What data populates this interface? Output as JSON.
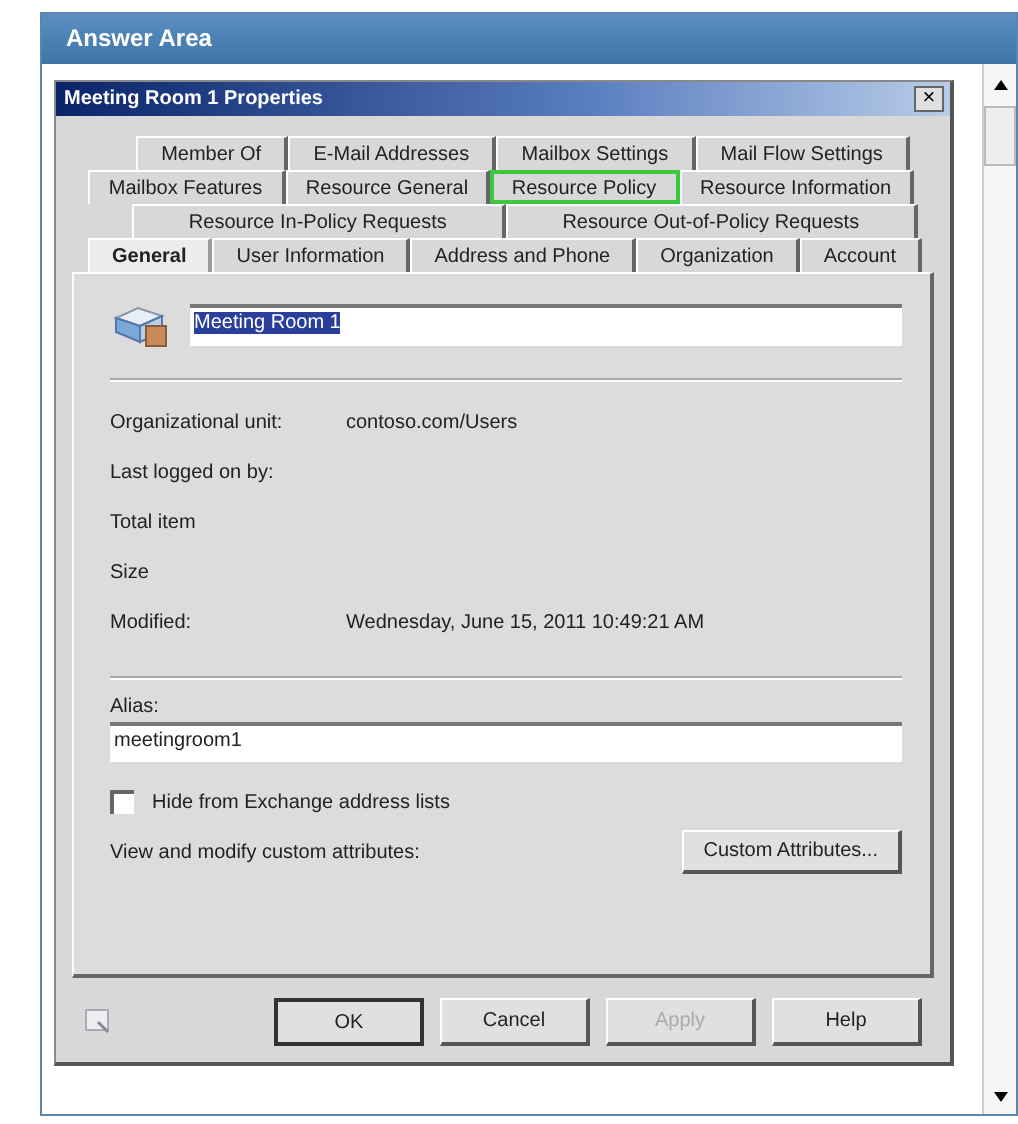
{
  "panel": {
    "title": "Answer Area"
  },
  "dialog": {
    "title": "Meeting Room 1 Properties",
    "close": "×"
  },
  "tab_rows": [
    [
      {
        "label": "Member Of",
        "selected": false,
        "highlighted": false
      },
      {
        "label": "E-Mail Addresses",
        "selected": false,
        "highlighted": false
      },
      {
        "label": "Mailbox Settings",
        "selected": false,
        "highlighted": false
      },
      {
        "label": "Mail Flow Settings",
        "selected": false,
        "highlighted": false
      }
    ],
    [
      {
        "label": "Mailbox Features",
        "selected": false,
        "highlighted": false
      },
      {
        "label": "Resource General",
        "selected": false,
        "highlighted": false
      },
      {
        "label": "Resource Policy",
        "selected": false,
        "highlighted": true
      },
      {
        "label": "Resource Information",
        "selected": false,
        "highlighted": false
      }
    ],
    [
      {
        "label": "Resource In-Policy Requests",
        "selected": false,
        "highlighted": false
      },
      {
        "label": "Resource Out-of-Policy Requests",
        "selected": false,
        "highlighted": false
      }
    ],
    [
      {
        "label": "General",
        "selected": true,
        "highlighted": false
      },
      {
        "label": "User Information",
        "selected": false,
        "highlighted": false
      },
      {
        "label": "Address and Phone",
        "selected": false,
        "highlighted": false
      },
      {
        "label": "Organization",
        "selected": false,
        "highlighted": false
      },
      {
        "label": "Account",
        "selected": false,
        "highlighted": false
      }
    ]
  ],
  "name_field": {
    "value": "Meeting Room 1"
  },
  "properties": [
    {
      "label": "Organizational unit:",
      "value": "contoso.com/Users"
    },
    {
      "label": "Last logged on by:"
    },
    {
      "label": "Total item"
    },
    {
      "label": "Size"
    },
    {
      "label": "Modified:",
      "value": "Wednesday, June 15, 2011 10:49:21 AM"
    }
  ],
  "alias": {
    "label": "Alias:",
    "value": "meetingroom1"
  },
  "hide_checkbox": {
    "label": "Hide from Exchange address lists",
    "checked": false
  },
  "custom": {
    "label": "View and modify custom attributes:",
    "button": "Custom Attributes..."
  },
  "buttons": [
    {
      "label": "OK",
      "disabled": false,
      "default": true
    },
    {
      "label": "Cancel",
      "disabled": false,
      "default": false
    },
    {
      "label": "Apply",
      "disabled": true,
      "default": false
    },
    {
      "label": "Help",
      "disabled": false,
      "default": false
    }
  ]
}
